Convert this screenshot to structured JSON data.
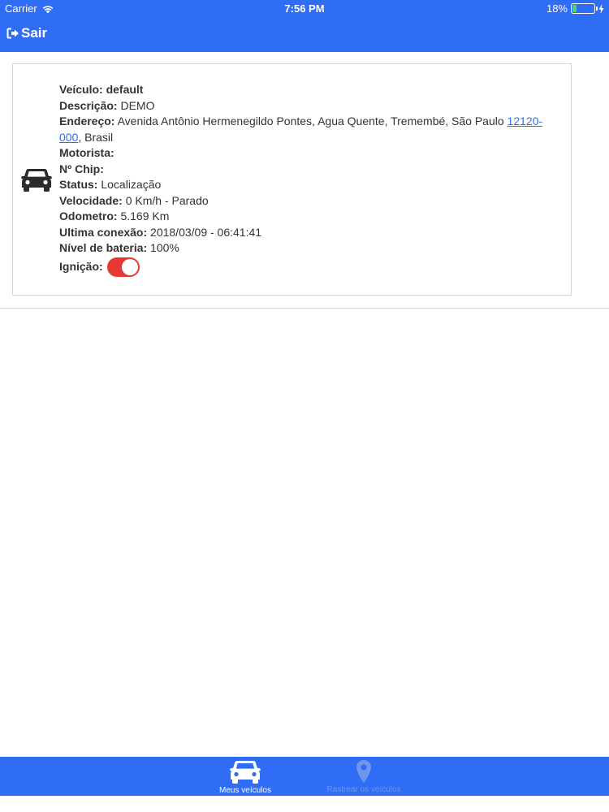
{
  "status_bar": {
    "carrier": "Carrier",
    "time": "7:56 PM",
    "battery_text": "18%",
    "battery_level": 0.18,
    "icons": [
      "wifi-icon",
      "battery-icon",
      "charging-bolt-icon"
    ]
  },
  "nav": {
    "logout_label": "Sair",
    "logout_icon": "logout-icon"
  },
  "vehicle": {
    "veiculo_label": "Veículo:",
    "veiculo_value": "default",
    "descricao_label": "Descrição:",
    "descricao_value": "DEMO",
    "endereco_label": "Endereço:",
    "endereco_value": "Avenida Antônio Hermenegildo Pontes, Agua Quente, Tremembé, São Paulo",
    "endereco_cep": "12120-000",
    "endereco_suffix": ", Brasil",
    "motorista_label": "Motorista:",
    "chip_label": "Nº Chip:",
    "status_label": "Status:",
    "status_value": "Localização",
    "velocidade_label": "Velocidade:",
    "velocidade_value": "0 Km/h - Parado",
    "odometro_label": "Odometro:",
    "odometro_value": "5.169 Km",
    "conexao_label": "Ultima conexão:",
    "conexao_value": "2018/03/09 - 06:41:41",
    "bateria_label": "Nível de bateria:",
    "bateria_value": "100%",
    "ignicao_label": "Ignição:",
    "ignicao_on": true,
    "icon": "car-icon"
  },
  "tabs": [
    {
      "label": "Meus veículos",
      "icon": "car-icon",
      "active": true
    },
    {
      "label": "Rastrear os veículos",
      "icon": "map-pin-icon",
      "active": false
    }
  ],
  "colors": {
    "primary": "#2f6df6",
    "toggle_on": "#e53935",
    "text": "#333333"
  }
}
